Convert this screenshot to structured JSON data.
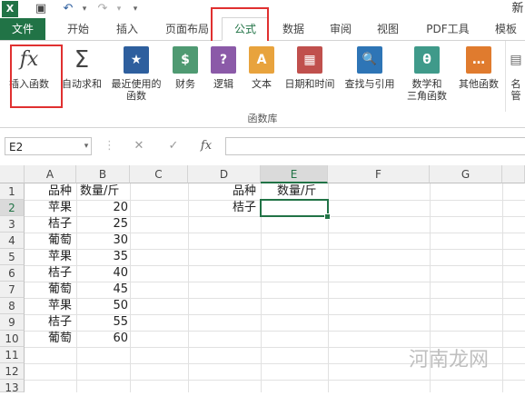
{
  "titlebar": {
    "excel_icon": "excel-logo-icon",
    "save_icon": "save-icon",
    "undo_icon": "undo-icon",
    "redo_icon": "redo-icon",
    "title_fragment": "新"
  },
  "tabs": [
    {
      "label": "文件"
    },
    {
      "label": "开始"
    },
    {
      "label": "插入"
    },
    {
      "label": "页面布局"
    },
    {
      "label": "公式"
    },
    {
      "label": "数据"
    },
    {
      "label": "审阅"
    },
    {
      "label": "视图"
    },
    {
      "label": "PDF工具"
    },
    {
      "label": "模板"
    }
  ],
  "ribbon": {
    "group_label": "函数库",
    "buttons": [
      {
        "label": "插入函数",
        "icon": "fx",
        "color": "#ffffff"
      },
      {
        "label": "自动求和",
        "icon": "Σ",
        "color": "#ffffff"
      },
      {
        "label": "最近使用的\n函数",
        "icon": "★",
        "color": "#2e5f9e"
      },
      {
        "label": "财务",
        "icon": "$",
        "color": "#4f9a72"
      },
      {
        "label": "逻辑",
        "icon": "?",
        "color": "#8b5aa8"
      },
      {
        "label": "文本",
        "icon": "A",
        "color": "#e8a33d"
      },
      {
        "label": "日期和时间",
        "icon": "▦",
        "color": "#c0504d"
      },
      {
        "label": "查找与引用",
        "icon": "🔍",
        "color": "#2e75b6"
      },
      {
        "label": "数学和\n三角函数",
        "icon": "θ",
        "color": "#3f9a8a"
      },
      {
        "label": "其他函数",
        "icon": "…",
        "color": "#e07b2e"
      },
      {
        "label": "名\n管",
        "icon": "",
        "color": "#ffffff"
      }
    ]
  },
  "formula_bar": {
    "name_box": "E2",
    "cancel_icon": "cancel-icon",
    "enter_icon": "check-icon",
    "fx_label": "fx",
    "formula": ""
  },
  "sheet": {
    "columns": [
      "A",
      "B",
      "C",
      "D",
      "E",
      "F",
      "G"
    ],
    "rows": [
      "1",
      "2",
      "3",
      "4",
      "5",
      "6",
      "7",
      "8",
      "9",
      "10",
      "11",
      "12",
      "13"
    ],
    "col_a": [
      "品种",
      "苹果",
      "桔子",
      "葡萄",
      "苹果",
      "桔子",
      "葡萄",
      "苹果",
      "桔子",
      "葡萄"
    ],
    "col_b": [
      "数量/斤",
      "20",
      "25",
      "30",
      "35",
      "40",
      "45",
      "50",
      "55",
      "60"
    ],
    "d1": "品种",
    "e1": "数量/斤",
    "d2": "桔子",
    "selected_cell": "E2"
  },
  "watermark": "河南龙网",
  "colors": {
    "accent": "#217346",
    "highlight": "#e03030"
  }
}
